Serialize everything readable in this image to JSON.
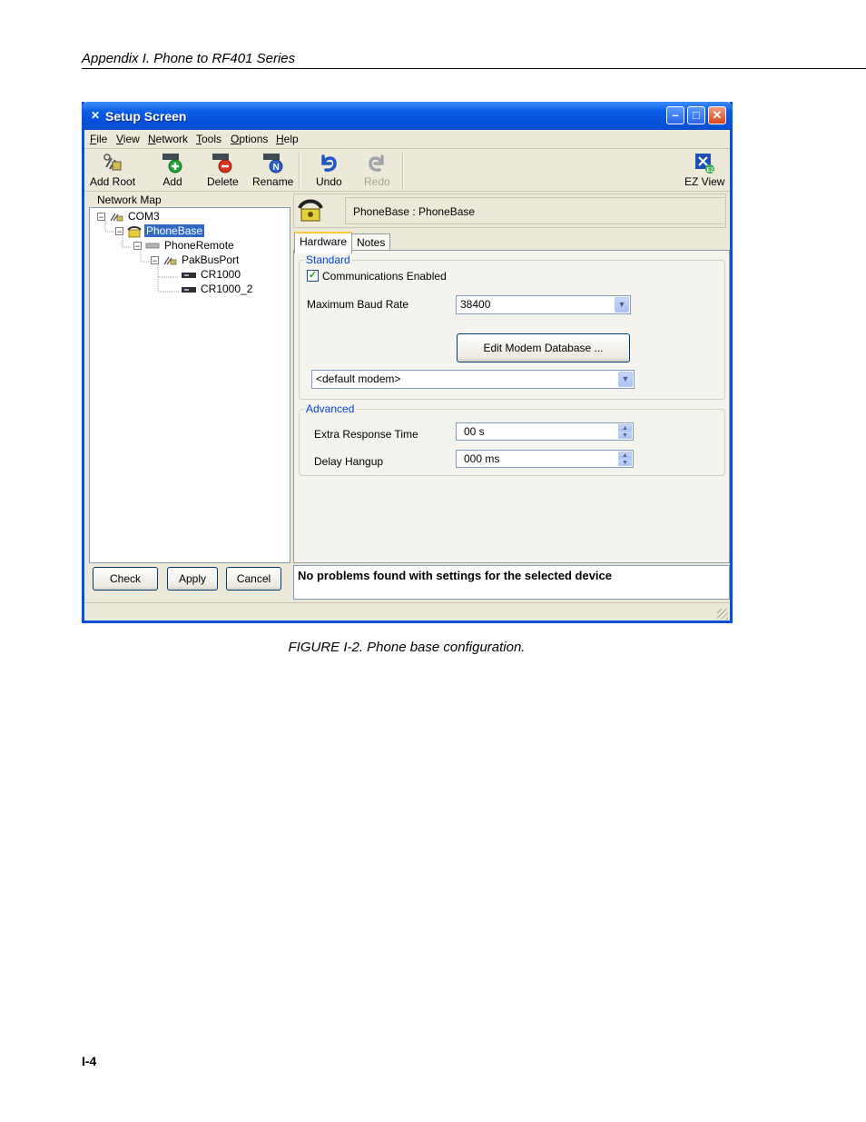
{
  "document": {
    "header": "Appendix I.  Phone to RF401 Series",
    "caption": "FIGURE I-2.  Phone base configuration.",
    "page_number": "I-4"
  },
  "window": {
    "title": "Setup Screen",
    "controls": {
      "minimize": "–",
      "maximize": "□",
      "close": "✕"
    }
  },
  "menu": [
    "File",
    "View",
    "Network",
    "Tools",
    "Options",
    "Help"
  ],
  "toolbar": {
    "add_root": "Add Root",
    "add": "Add",
    "delete": "Delete",
    "rename": "Rename",
    "undo": "Undo",
    "redo": "Redo",
    "ez_view": "EZ View"
  },
  "network_map": {
    "label": "Network Map",
    "nodes": [
      {
        "label": "COM3",
        "expander": "−"
      },
      {
        "label": "PhoneBase",
        "expander": "−",
        "selected": true
      },
      {
        "label": "PhoneRemote",
        "expander": "−"
      },
      {
        "label": "PakBusPort",
        "expander": "−"
      },
      {
        "label": "CR1000"
      },
      {
        "label": "CR1000_2"
      }
    ]
  },
  "buttons": {
    "check": "Check",
    "apply": "Apply",
    "cancel": "Cancel"
  },
  "device": {
    "name": "PhoneBase : PhoneBase"
  },
  "tabs": [
    "Hardware",
    "Notes"
  ],
  "standard": {
    "title": "Standard",
    "comm_enabled_label": "Communications Enabled",
    "comm_enabled_mark": "✓",
    "baud_label": "Maximum Baud Rate",
    "baud_value": "38400",
    "edit_modem_button": "Edit Modem Database ...",
    "modem_value": "<default modem>"
  },
  "advanced": {
    "title": "Advanced",
    "extra_response_label": "Extra Response Time",
    "extra_response_value": "00 s",
    "delay_hangup_label": "Delay Hangup",
    "delay_hangup_value": "000 ms"
  },
  "status_message": "No problems found with settings for the selected device",
  "colors": {
    "title_bar": "#0a5de6",
    "selection": "#316ac5",
    "group_title": "#0046d5",
    "window_bg": "#ece9d8"
  }
}
